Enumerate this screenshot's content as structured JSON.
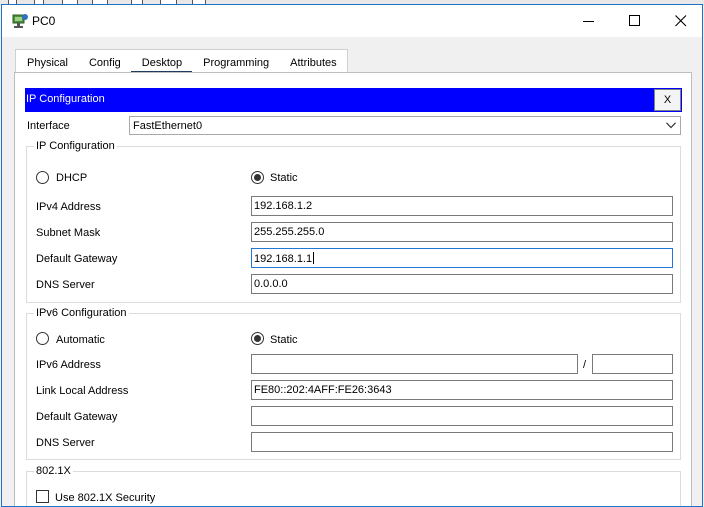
{
  "window": {
    "title": "PC0"
  },
  "tabs": [
    "Physical",
    "Config",
    "Desktop",
    "Programming",
    "Attributes"
  ],
  "active_tab": "Desktop",
  "ipconfig": {
    "header_title": "IP Configuration",
    "close_label": "X",
    "interface_label": "Interface",
    "interface_value": "FastEthernet0"
  },
  "ipv4": {
    "group_title": "IP Configuration",
    "dhcp_label": "DHCP",
    "static_label": "Static",
    "selected_mode": "Static",
    "rows": [
      {
        "label": "IPv4 Address",
        "value": "192.168.1.2"
      },
      {
        "label": "Subnet Mask",
        "value": "255.255.255.0"
      },
      {
        "label": "Default Gateway",
        "value": "192.168.1.1"
      },
      {
        "label": "DNS Server",
        "value": "0.0.0.0"
      }
    ]
  },
  "ipv6": {
    "group_title": "IPv6 Configuration",
    "automatic_label": "Automatic",
    "static_label": "Static",
    "selected_mode": "Static",
    "address_label": "IPv6 Address",
    "address_value": "",
    "prefix_separator": "/",
    "prefix_value": "",
    "link_local_label": "Link Local Address",
    "link_local_value": "FE80::202:4AFF:FE26:3643",
    "gateway_label": "Default Gateway",
    "gateway_value": "",
    "dns_label": "DNS Server",
    "dns_value": ""
  },
  "dot1x": {
    "group_title": "802.1X",
    "use_security_label": "Use 802.1X Security",
    "checked": false
  }
}
